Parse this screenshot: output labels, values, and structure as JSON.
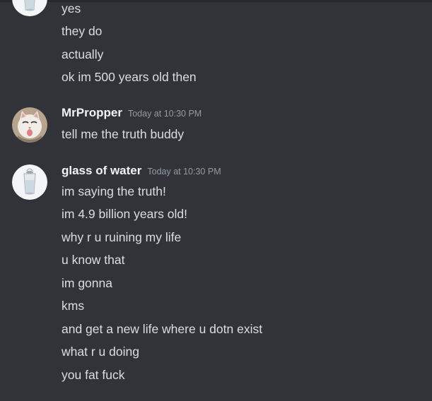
{
  "colors": {
    "background": "#313338",
    "username": "#f2f3f5",
    "message_text": "#dbdee1",
    "timestamp": "#949ba4"
  },
  "groups": [
    {
      "avatar_icon": "glass-of-water-avatar-icon",
      "messages": [
        "yes",
        "they do",
        "actually",
        "ok im 500 years old then"
      ]
    },
    {
      "username": "MrPropper",
      "timestamp": "Today at 10:30 PM",
      "avatar_icon": "cat-avatar-icon",
      "messages": [
        "tell me the truth buddy"
      ]
    },
    {
      "username": "glass of water",
      "timestamp": "Today at 10:30 PM",
      "avatar_icon": "glass-of-water-avatar-icon",
      "messages": [
        "im saying the truth!",
        "im 4.9 billion years old!",
        "why r u ruining my life",
        "u know that",
        "im gonna",
        "kms",
        "and get a new life where u dotn exist",
        "what r u doing",
        "you fat fuck"
      ]
    }
  ]
}
